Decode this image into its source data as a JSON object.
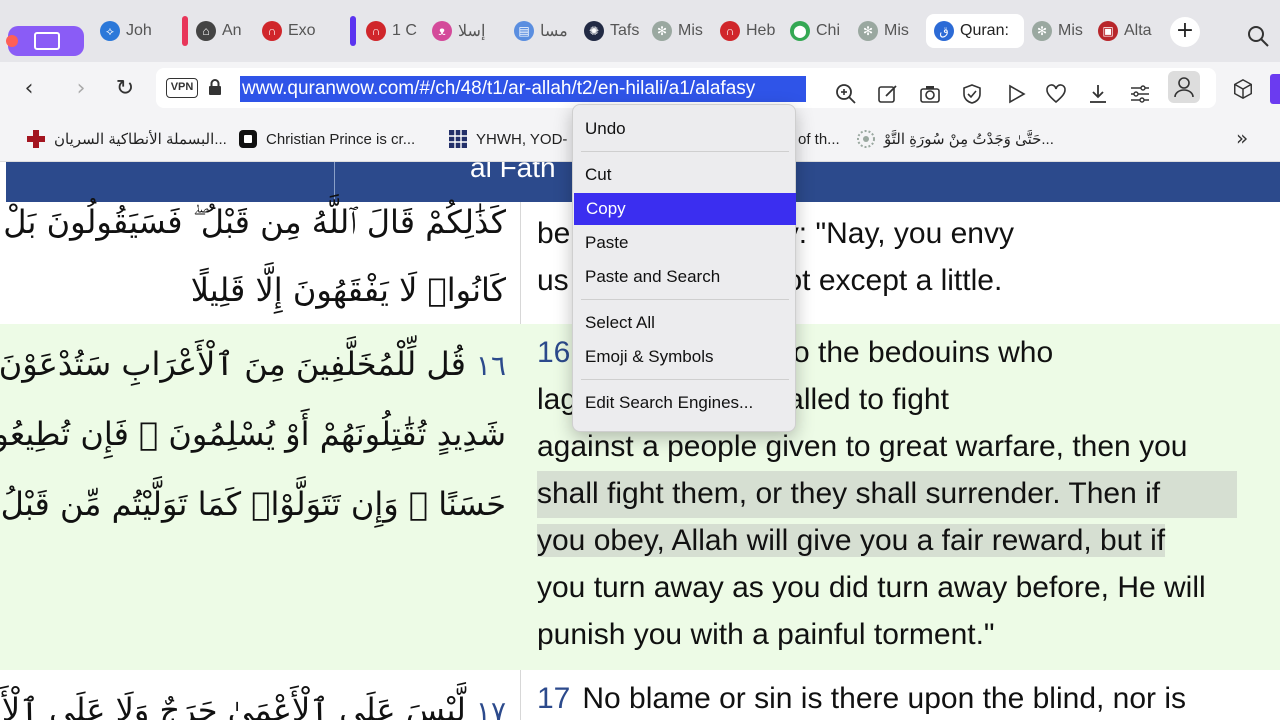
{
  "tabs": [
    {
      "label": "Joh",
      "icon": "blue-bird-icon",
      "color": "#2b78d9"
    },
    {
      "label": "An",
      "icon": "home-icon",
      "color": "#444444"
    },
    {
      "label": "Exo",
      "icon": "arch-icon",
      "color": "#d0262b"
    },
    {
      "label": "1 C",
      "icon": "arch-icon",
      "color": "#d0262b"
    },
    {
      "label": "إسلا",
      "icon": "cat-icon",
      "color": "#d44a9a"
    },
    {
      "label": "مسا",
      "icon": "document-icon",
      "color": "#5a8ee0"
    },
    {
      "label": "Tafs",
      "icon": "seal-icon",
      "color": "#222a44"
    },
    {
      "label": "Mis",
      "icon": "star-ornament-icon",
      "color": "#9aa8a0"
    },
    {
      "label": "Heb",
      "icon": "arch-icon",
      "color": "#d0262b"
    },
    {
      "label": "Chi",
      "icon": "map-pin-icon",
      "color": "#34a853"
    },
    {
      "label": "Mis",
      "icon": "star-ornament-icon",
      "color": "#9aa8a0"
    },
    {
      "label": "Quran:",
      "icon": "quran-q-icon",
      "color": "#2c6bd6",
      "active": true
    },
    {
      "label": "Mis",
      "icon": "star-ornament-icon",
      "color": "#9aa8a0"
    },
    {
      "label": "Alta",
      "icon": "shrine-icon",
      "color": "#b8262b"
    }
  ],
  "toolbar": {
    "vpn_label": "VPN",
    "url": "www.quranwow.com/#/ch/48/t1/ar-allah/t2/en-hilali/a1/alafasy"
  },
  "bookmarks": [
    {
      "label": "البسملة الأنطاكية السريان...",
      "icon": "red-cross-icon"
    },
    {
      "label": "Christian Prince is cr...",
      "icon": "black-square-icon"
    },
    {
      "label": "YHWH, YOD-",
      "icon": "grid-icon"
    },
    {
      "label": "of th...",
      "icon": ""
    },
    {
      "label": "حَتَّىٰ وَجَدْتُ مِنْ سُورَةِ التَّوْ...",
      "icon": "star-ornament-icon"
    }
  ],
  "page": {
    "header_title": "al Fath",
    "verses": [
      {
        "number": "",
        "arabic_number": "",
        "arabic_lines": [
          "كَذَٰلِكُمْ قَالَ ٱللَّهُ مِن قَبْلُ ۖ فَسَيَقُولُونَ بَلْ",
          "كَانُوا۟ لَا يَفْقَهُونَ إِلَّا قَلِيلًا"
        ],
        "english_lines": [
          "",
          "be ... n they will say: \"Nay, you envy",
          "us ... understand not except a little."
        ]
      },
      {
        "number": "16",
        "arabic_number": "١٦",
        "arabic_lines": [
          "قُل لِّلْمُخَلَّفِينَ مِنَ ٱلْأَعْرَابِ سَتُدْعَوْنَ",
          "شَدِيدٍ تُقَٰتِلُونَهُمْ أَوْ يُسْلِمُونَ ۖ فَإِن تُطِيعُوا۟",
          "حَسَنًا ۖ وَإِن تَتَوَلَّوْا۟ كَمَا تَوَلَّيْتُم مِّن قَبْلُ يُعَ"
        ],
        "english_lines": [
          "... hmad SAW) to the bedouins who",
          "lag ... ou shall be called to fight",
          "against a people given to great warfare, then you",
          "shall fight them, or they shall surrender. Then if",
          "you obey, Allah will give you a fair reward, but if",
          "you turn away as you did turn away before, He will",
          "punish you with a painful torment.\""
        ]
      },
      {
        "number": "17",
        "arabic_number": "١٧",
        "arabic_lines": [
          "لَّيْسَ عَلَى ٱلْأَعْمَىٰ حَرَجٌ وَلَا عَلَى ٱلْأَعْ"
        ],
        "english_lines": [
          "No blame or sin is there upon the blind, nor is"
        ]
      }
    ]
  },
  "context_menu": {
    "items": [
      {
        "label": "Undo"
      },
      {
        "label": "Cut"
      },
      {
        "label": "Copy",
        "selected": true
      },
      {
        "label": "Paste"
      },
      {
        "label": "Paste and Search"
      },
      {
        "label": "Select All"
      },
      {
        "label": "Emoji & Symbols"
      },
      {
        "label": "Edit Search Engines..."
      }
    ]
  },
  "colors": {
    "url_highlight": "#2f54e8",
    "menu_selected": "#3b2ef0",
    "header_blue": "#2c4a8c",
    "verse_shade": "#edfbe6",
    "workspace_purple": "#8a5cf6"
  }
}
